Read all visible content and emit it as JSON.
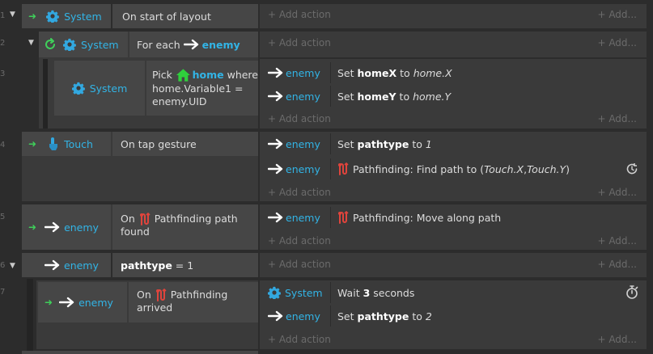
{
  "rows": [
    {
      "num": "1"
    },
    {
      "num": "2"
    },
    {
      "num": "3"
    },
    {
      "num": "4"
    },
    {
      "num": "5"
    },
    {
      "num": "6"
    },
    {
      "num": "7"
    }
  ],
  "labels": {
    "add_action": "Add action",
    "add_more": "Add..."
  },
  "objects": {
    "system": "System",
    "touch": "Touch",
    "enemy": "enemy"
  },
  "ev1": {
    "condition": "On start of layout"
  },
  "ev2": {
    "for_each": "For each",
    "object": "enemy"
  },
  "ev3": {
    "pick": "Pick",
    "home": "home",
    "where": "where",
    "line2": "home.Variable1 =",
    "line3": "enemy.UID",
    "act1": {
      "set": "Set",
      "var": "homeX",
      "to": "to",
      "val": "home.X"
    },
    "act2": {
      "set": "Set",
      "var": "homeY",
      "to": "to",
      "val": "home.Y"
    }
  },
  "ev4": {
    "condition": "On tap gesture",
    "act1": {
      "set": "Set",
      "var": "pathtype",
      "to": "to",
      "val": "1"
    },
    "act2": {
      "prefix": "Pathfinding: Find path to (",
      "x": "Touch.X",
      "sep": ", ",
      "y": "Touch.Y",
      "suffix": ")"
    }
  },
  "ev5": {
    "on": "On",
    "line1": "Pathfinding path",
    "line2": "found",
    "act1": "Pathfinding: Move along path"
  },
  "ev6": {
    "var": "pathtype",
    "rest": "= 1"
  },
  "ev7": {
    "on": "On",
    "line1": "Pathfinding",
    "line2": "arrived",
    "act1": {
      "wait": "Wait",
      "num": "3",
      "unit": "seconds"
    },
    "act2": {
      "set": "Set",
      "var": "pathtype",
      "to": "to",
      "val": "2"
    }
  },
  "colors": {
    "accent_blue": "#32b4e6",
    "trigger_green": "#3fcf5a",
    "pathfinding_red": "#e0443c",
    "home_green": "#2fcf3c"
  }
}
